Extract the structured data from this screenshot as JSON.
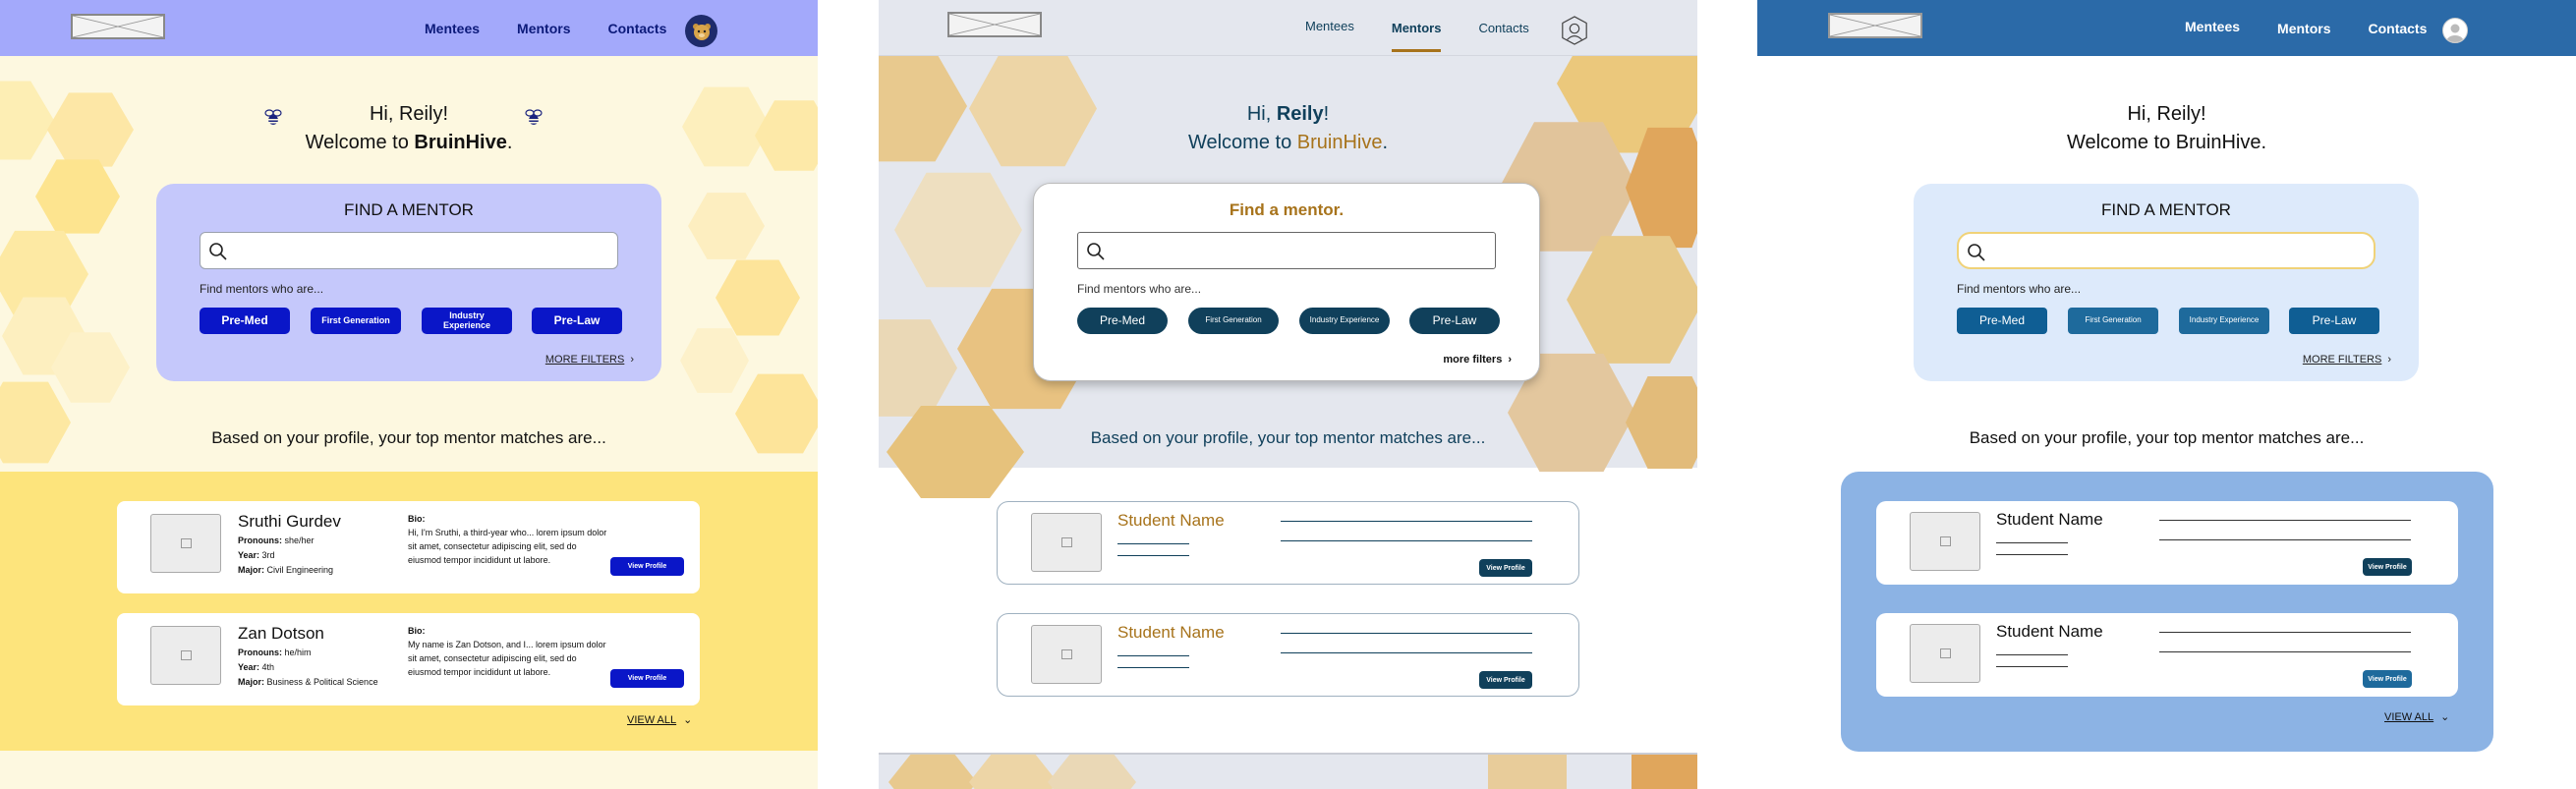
{
  "nav": {
    "links": [
      "Mentees",
      "Mentors",
      "Contacts"
    ]
  },
  "hero": {
    "greeting_a": "Hi, Reily!",
    "welcome_a": "Welcome to ",
    "brand": "BruinHive",
    "period": ".",
    "greeting_hi": "Hi, ",
    "name": "Reily",
    "welcome_plain": "Welcome to BruinHive."
  },
  "finder": {
    "title_caps": "FIND A MENTOR",
    "title_sentence": "Find a mentor.",
    "label": "Find mentors who are...",
    "chips": [
      "Pre-Med",
      "First Generation",
      "Industry Experience",
      "Pre-Law"
    ],
    "more_caps": "MORE FILTERS",
    "more_lower": "more filters"
  },
  "matches": {
    "title": "Based on your profile, your top mentor matches are...",
    "view_all": "VIEW ALL",
    "view_profile": "View Profile",
    "placeholder_name": "Student Name",
    "bio_label": "Bio:",
    "pronouns_label": "Pronouns:",
    "year_label": "Year:",
    "major_label": "Major:",
    "mentors": [
      {
        "name": "Sruthi Gurdev",
        "pronouns": "she/her",
        "year": "3rd",
        "major": "Civil Engineering",
        "bio": "Hi, I'm Sruthi, a third-year who... lorem ipsum dolor sit amet, consectetur adipiscing elit, sed do eiusmod tempor incididunt ut labore."
      },
      {
        "name": "Zan Dotson",
        "pronouns": "he/him",
        "year": "4th",
        "major": "Business & Political Science",
        "bio": "My name is Zan Dotson, and I... lorem ipsum dolor sit amet, consectetur adipiscing elit, sed do eiusmod tempor incididunt ut labore."
      }
    ]
  },
  "colors": {
    "v1_nav": "#a3a9fb",
    "v1_bg": "#fdf8e0",
    "v1_btn": "#0a16c8",
    "v2_gold": "#a7731b",
    "v2_navy": "#10405b",
    "v3_nav": "#2b6aa8",
    "v3_btn": "#0f5e94"
  }
}
